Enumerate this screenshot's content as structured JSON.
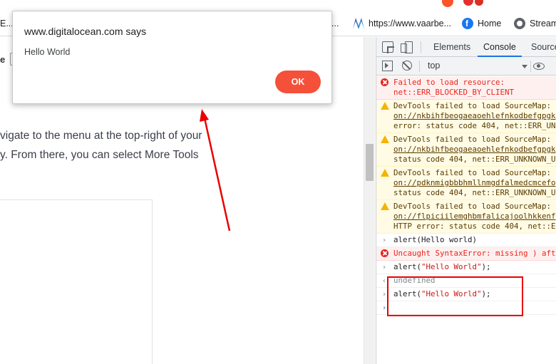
{
  "bookmarks": {
    "frag1": "E...",
    "frag2": "...",
    "vaarbe": "https://www.vaarbe...",
    "home": "Home",
    "stream": "Stream..."
  },
  "page": {
    "frag": "e",
    "para1": "vigate to the menu at the top-right of your",
    "para2": "y. From there, you can select More Tools"
  },
  "dialog": {
    "title": "www.digitalocean.com says",
    "message": "Hello World",
    "ok_label": "OK"
  },
  "devtools": {
    "tabs": {
      "elements": "Elements",
      "console": "Console",
      "sources": "Source"
    },
    "context": "top",
    "logs": [
      {
        "type": "error",
        "lines": [
          "Failed to load resource:",
          "net::ERR_BLOCKED_BY_CLIENT"
        ]
      },
      {
        "type": "warn",
        "lines": [
          "DevTools failed to load SourceMap:",
          "on://nkbihfbeogaeaoehlefnkodbefgpgk",
          "error: status code 404, net::ERR_UN"
        ]
      },
      {
        "type": "warn",
        "lines": [
          "DevTools failed to load SourceMap:",
          "on://nkbihfbeogaeaoehlefnkodbefgpgk",
          "status code 404, net::ERR_UNKNOWN_U"
        ]
      },
      {
        "type": "warn",
        "lines": [
          "DevTools failed to load SourceMap:",
          "on://pdknmigbbbhmllnmgdfalmedcmcefo",
          "status code 404, net::ERR_UNKNOWN_U"
        ]
      },
      {
        "type": "warn",
        "lines": [
          "DevTools failed to load SourceMap:",
          "on://flpiciilemghbmfalicajoolhkkenf",
          "HTTP error: status code 404, net::E"
        ]
      },
      {
        "type": "input",
        "lines": [
          "alert(Hello world)"
        ]
      },
      {
        "type": "error",
        "lines": [
          "Uncaught SyntaxError: missing ) aft"
        ]
      },
      {
        "type": "input",
        "pre": "  alert(",
        "str": "\"Hello World\"",
        "post": ");"
      },
      {
        "type": "result",
        "lines": [
          "undefined"
        ]
      },
      {
        "type": "input",
        "pre": "  alert(",
        "str": "\"Hello World\"",
        "post": ");"
      },
      {
        "type": "prompt",
        "lines": [
          ""
        ]
      }
    ]
  },
  "colors": {
    "ok_button": "#f5503a",
    "annotation_red": "#ea0000",
    "error_text": "#e6261c",
    "console_tab_underline": "#1a73e8"
  }
}
